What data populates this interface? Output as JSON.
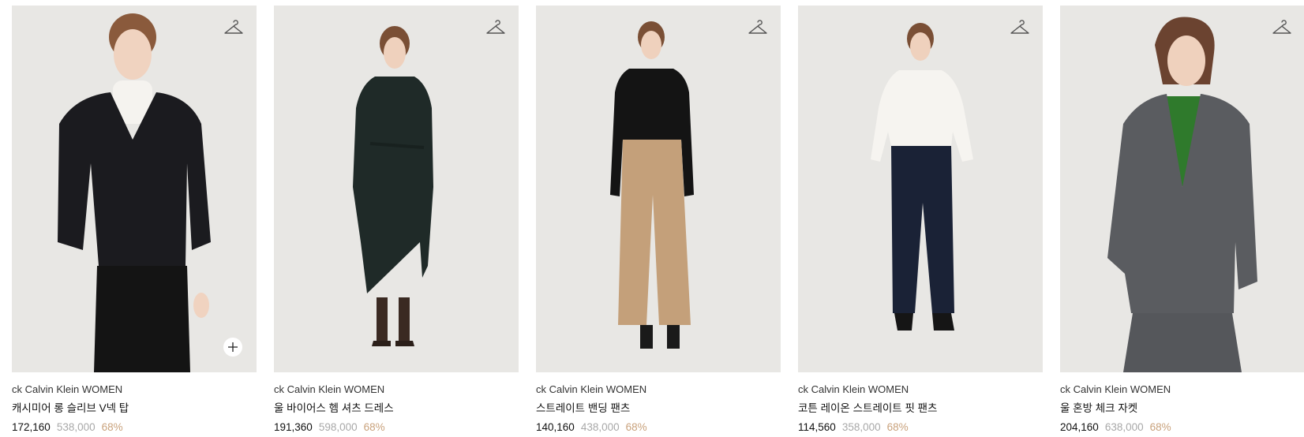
{
  "icons": {
    "hanger": "hanger-icon",
    "plus": "plus-icon"
  },
  "colors": {
    "background": "#e7e6e3",
    "discount": "#c9a27c",
    "original_price": "#a8a8a8"
  },
  "products": [
    {
      "brand": "ck Calvin Klein WOMEN",
      "name": "캐시미어 롱 슬리브 V넥 탑",
      "price": "172,160",
      "original_price": "538,000",
      "discount": "68%",
      "has_plus_button": true
    },
    {
      "brand": "ck Calvin Klein WOMEN",
      "name": "울 바이어스 헴 셔츠 드레스",
      "price": "191,360",
      "original_price": "598,000",
      "discount": "68%",
      "has_plus_button": false
    },
    {
      "brand": "ck Calvin Klein WOMEN",
      "name": "스트레이트 밴딩 팬츠",
      "price": "140,160",
      "original_price": "438,000",
      "discount": "68%",
      "has_plus_button": false
    },
    {
      "brand": "ck Calvin Klein WOMEN",
      "name": "코튼 레이온 스트레이트 핏 팬츠",
      "price": "114,560",
      "original_price": "358,000",
      "discount": "68%",
      "has_plus_button": false
    },
    {
      "brand": "ck Calvin Klein WOMEN",
      "name": "울 혼방 체크 자켓",
      "price": "204,160",
      "original_price": "638,000",
      "discount": "68%",
      "has_plus_button": false
    }
  ]
}
